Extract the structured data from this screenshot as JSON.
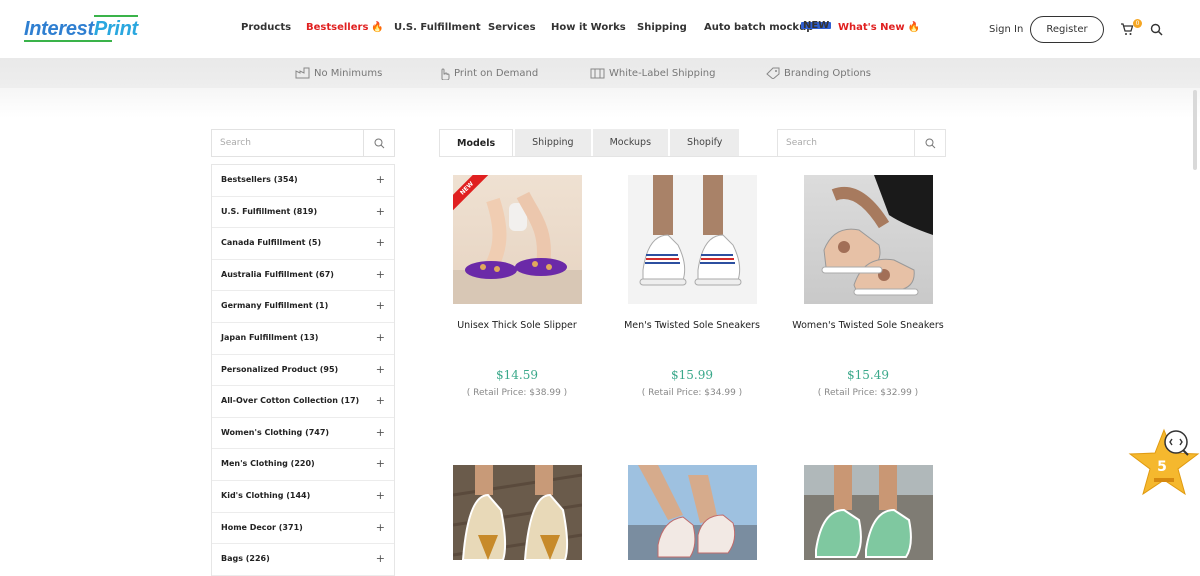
{
  "header": {
    "logo_part1": "Interest",
    "logo_part2": "Print",
    "nav": [
      {
        "label": "Products",
        "red": false
      },
      {
        "label": "Bestsellers",
        "red": true
      },
      {
        "label": "U.S. Fulfillment",
        "red": false
      },
      {
        "label": "Services",
        "red": false
      },
      {
        "label": "How it Works",
        "red": false
      },
      {
        "label": "Shipping",
        "red": false
      },
      {
        "label": "Auto batch mockup",
        "red": false,
        "badge": "NEW"
      },
      {
        "label": "What's New",
        "red": true
      }
    ],
    "signin": "Sign In",
    "register": "Register",
    "cart_count": "0"
  },
  "features": [
    {
      "label": "No Minimums",
      "icon": "factory-icon"
    },
    {
      "label": "Print on Demand",
      "icon": "hand-pointer-icon"
    },
    {
      "label": "White-Label Shipping",
      "icon": "package-icon"
    },
    {
      "label": "Branding Options",
      "icon": "tag-icon"
    }
  ],
  "sidebar": {
    "search_placeholder": "Search",
    "categories": [
      "Bestsellers (354)",
      "U.S. Fulfillment (819)",
      "Canada Fulfillment (5)",
      "Australia Fulfillment (67)",
      "Germany Fulfillment (1)",
      "Japan Fulfillment (13)",
      "Personalized Product (95)",
      "All-Over Cotton Collection (17)",
      "Women's Clothing (747)",
      "Men's Clothing (220)",
      "Kid's Clothing (144)",
      "Home Decor (371)",
      "Bags (226)"
    ],
    "expand_symbol": "+"
  },
  "main": {
    "tabs": [
      "Models",
      "Shipping",
      "Mockups",
      "Shopify"
    ],
    "active_tab": "Models",
    "search_placeholder": "Search",
    "products": [
      {
        "name": "Unisex Thick Sole Slipper",
        "price": "$14.59",
        "retail": "( Retail Price: $38.99 )",
        "badge": "NEW"
      },
      {
        "name": "Men's Twisted Sole Sneakers",
        "price": "$15.99",
        "retail": "( Retail Price: $34.99 )"
      },
      {
        "name": "Women's Twisted Sole Sneakers",
        "price": "$15.49",
        "retail": "( Retail Price: $32.99 )"
      },
      {
        "name": "",
        "price": "",
        "retail": ""
      },
      {
        "name": "",
        "price": "",
        "retail": ""
      },
      {
        "name": "",
        "price": "",
        "retail": ""
      }
    ]
  },
  "rating_widget": {
    "value": "5"
  },
  "colors": {
    "accent_red": "#e02020",
    "price_green": "#3aa88a",
    "logo_blue": "#2f7fd1",
    "logo_green": "#3ab34a",
    "star_gold": "#f5b82e"
  }
}
